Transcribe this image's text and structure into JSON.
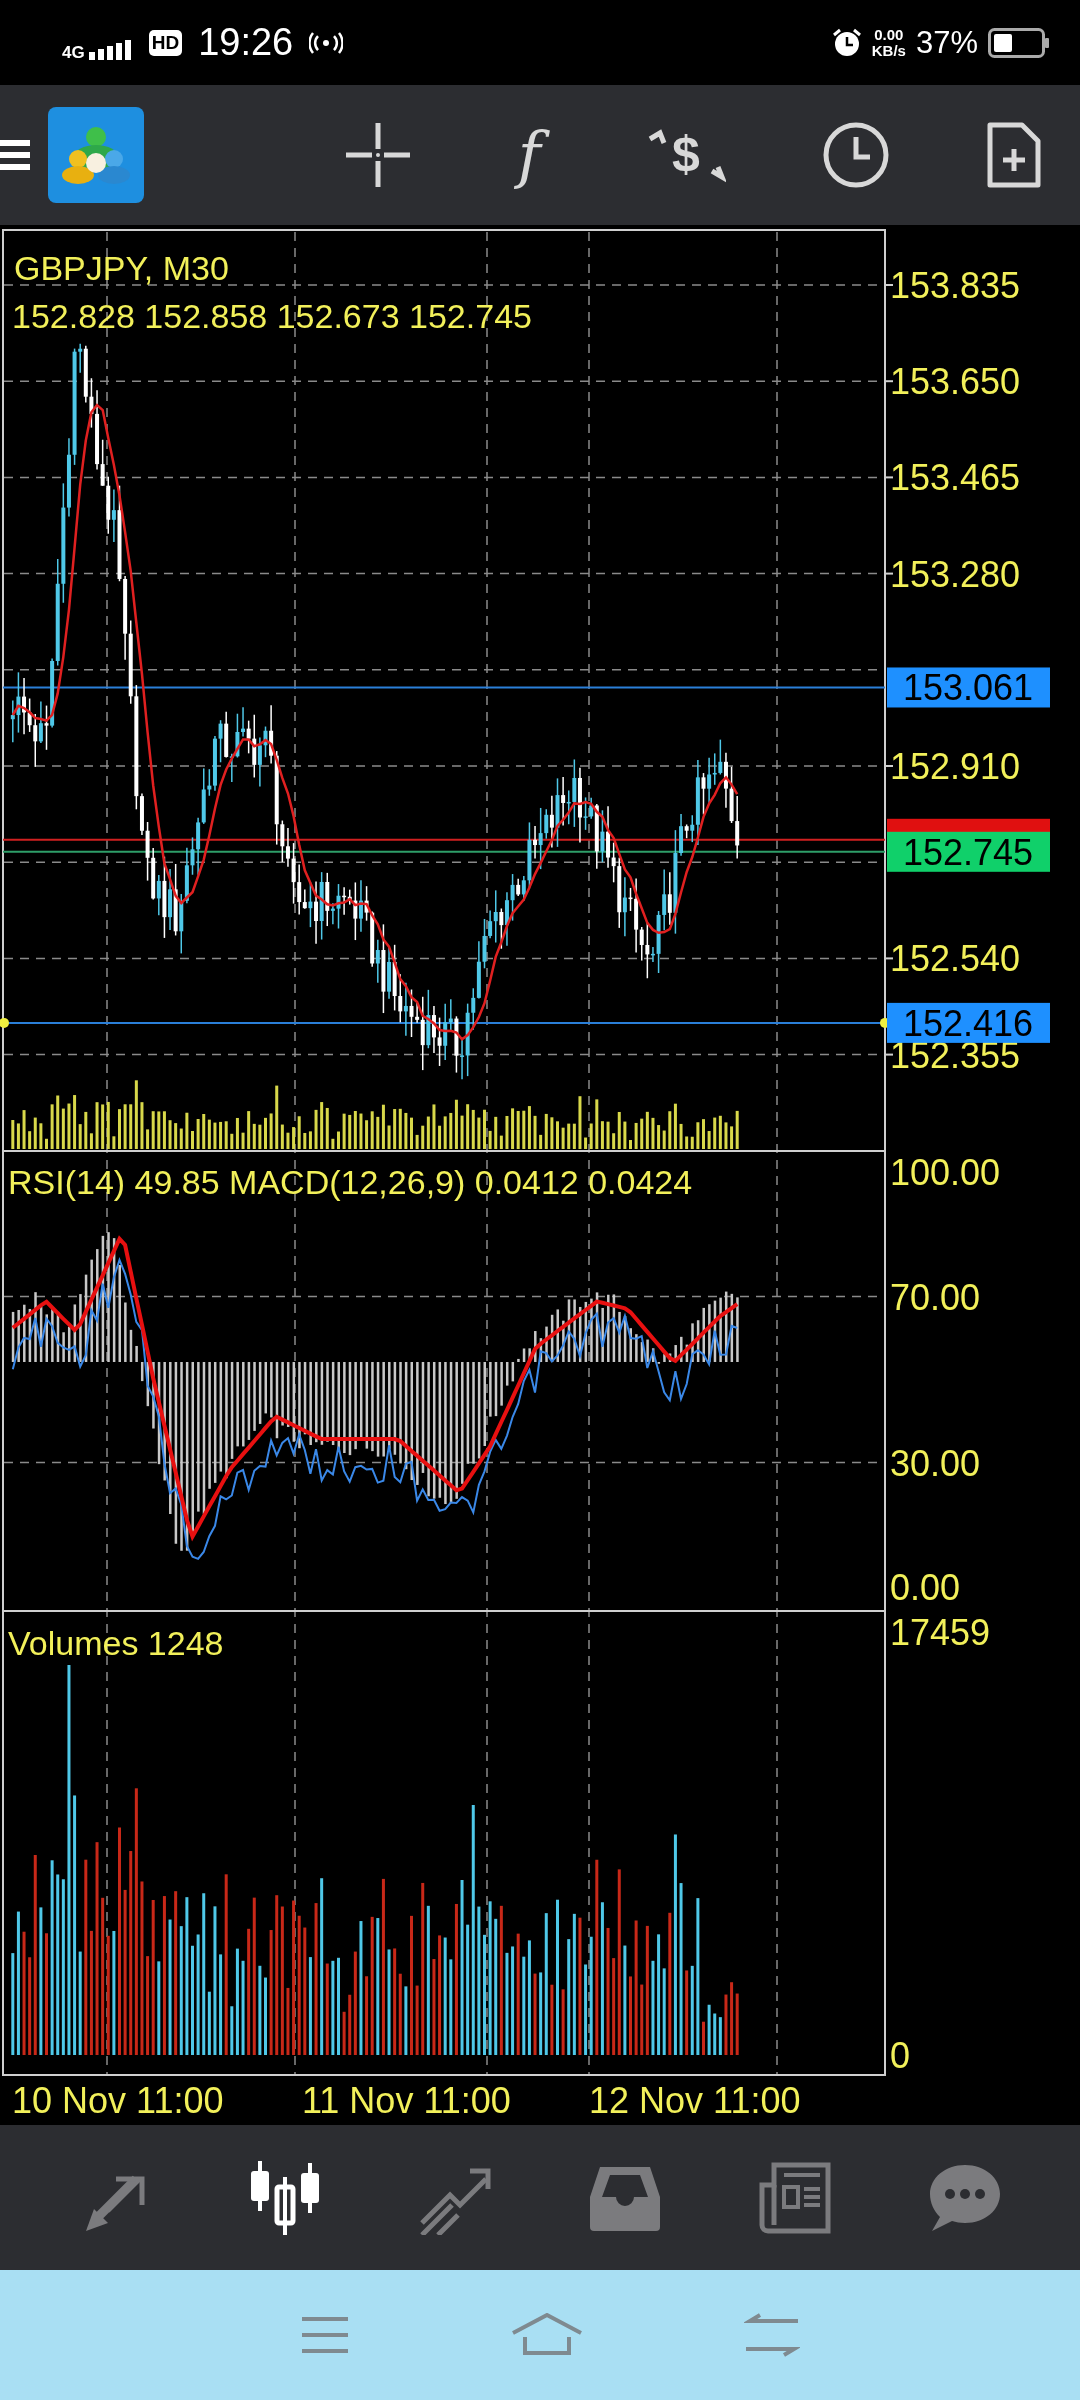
{
  "status_bar": {
    "network": "4G",
    "hd": "HD",
    "time": "19:26",
    "speed_value": "0.00",
    "speed_unit": "KB/s",
    "battery": "37%"
  },
  "toolbar": {
    "function_symbol": "f",
    "currency_symbol": "$"
  },
  "main_chart": {
    "symbol": "GBPJPY, M30",
    "ohlc": "152.828 152.858 152.673 152.745",
    "price_labels": [
      "153.835",
      "153.650",
      "153.465",
      "153.280",
      "152.910",
      "152.540",
      "152.355"
    ],
    "markers": [
      {
        "text": "153.061",
        "kind": "line"
      },
      {
        "text": "152.745",
        "kind": "bid"
      },
      {
        "text": "152.416",
        "kind": "line"
      }
    ]
  },
  "indicator_panel": {
    "title": "RSI(14) 49.85 MACD(12,26,9) 0.0412 0.0424",
    "levels": [
      "100.00",
      "70.00",
      "30.00",
      "0.00"
    ]
  },
  "volume_panel": {
    "title": "Volumes 1248",
    "max_label": "17459",
    "min_label": "0"
  },
  "time_axis": [
    "10 Nov 11:00",
    "11 Nov 11:00",
    "12 Nov 11:00"
  ],
  "bottom_nav": [
    {
      "kind": "quotes",
      "selected": false
    },
    {
      "kind": "chart",
      "selected": true
    },
    {
      "kind": "trade",
      "selected": false
    },
    {
      "kind": "history",
      "selected": false
    },
    {
      "kind": "news",
      "selected": false
    },
    {
      "kind": "chat",
      "selected": false
    }
  ]
}
